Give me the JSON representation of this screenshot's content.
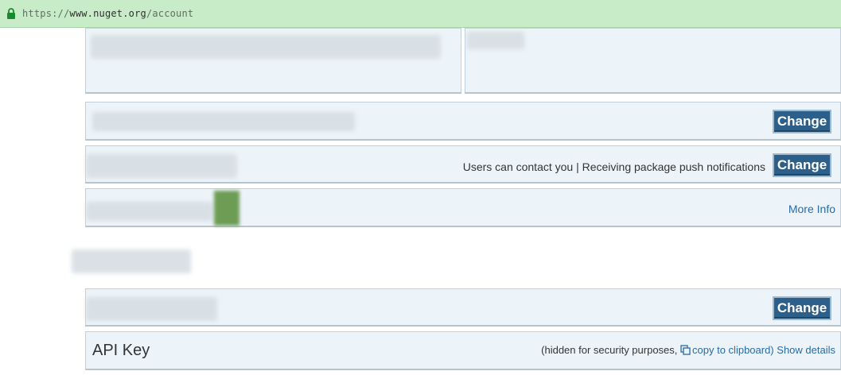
{
  "browser": {
    "url_scheme": "https://",
    "url_host": "www.nuget.org",
    "url_path": "/account",
    "lock_icon": "lock-icon",
    "accent_color": "#c8ebc8"
  },
  "account": {
    "change_label": "Change",
    "contact_status": "Users can contact you | Receiving package push notifications",
    "more_info_label": "More Info"
  },
  "api_key": {
    "title": "API Key",
    "hidden_note": "(hidden for security purposes,",
    "copy_label": "copy to clipboard)",
    "show_details_label": "Show details"
  },
  "colors": {
    "button_bg": "#2c5f8a",
    "panel_bg": "#edf4f9",
    "link": "#2a6aa5"
  }
}
